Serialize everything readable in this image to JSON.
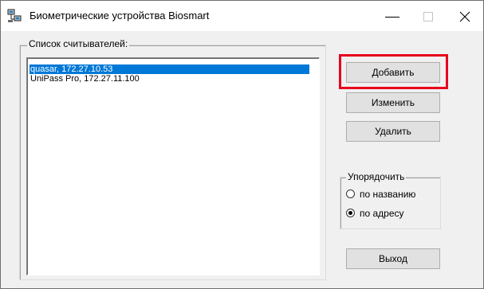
{
  "window": {
    "title": "Биометрические устройства Biosmart",
    "icon": "network-computers-icon",
    "controls": {
      "minimize_icon": "minimize-icon",
      "maximize_icon": "maximize-icon",
      "close_icon": "close-icon"
    }
  },
  "readers": {
    "group_label": "Список считывателей:",
    "items": [
      {
        "text": "quasar, 172.27.10.53",
        "selected": true
      },
      {
        "text": "UniPass Pro, 172.27.11.100",
        "selected": false
      }
    ]
  },
  "actions": {
    "add": "Добавить",
    "edit": "Изменить",
    "delete": "Удалить",
    "exit": "Выход"
  },
  "sort": {
    "group_label": "Упорядочить",
    "options": [
      {
        "label": "по названию",
        "checked": false
      },
      {
        "label": "по адресу",
        "checked": true
      }
    ]
  },
  "colors": {
    "selection": "#0078d7",
    "highlight_frame": "#e8001c",
    "window_bg": "#f0f0f0"
  }
}
